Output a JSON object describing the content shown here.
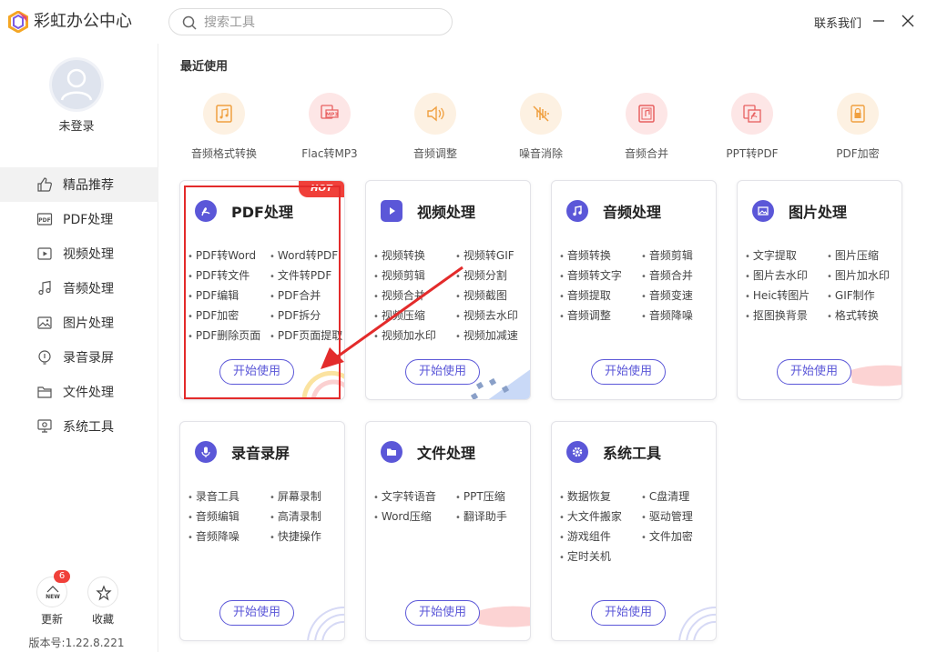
{
  "app": {
    "title": "彩虹办公中心"
  },
  "search": {
    "placeholder": "搜索工具"
  },
  "header": {
    "contact": "联系我们"
  },
  "user": {
    "login_status": "未登录"
  },
  "sidebar": {
    "items": [
      {
        "label": "精品推荐",
        "icon": "thumbs-up-icon",
        "active": true
      },
      {
        "label": "PDF处理",
        "icon": "pdf-icon"
      },
      {
        "label": "视频处理",
        "icon": "video-icon"
      },
      {
        "label": "音频处理",
        "icon": "music-note-icon"
      },
      {
        "label": "图片处理",
        "icon": "image-icon"
      },
      {
        "label": "录音录屏",
        "icon": "lightbulb-icon"
      },
      {
        "label": "文件处理",
        "icon": "folder-icon"
      },
      {
        "label": "系统工具",
        "icon": "monitor-icon"
      }
    ],
    "update": {
      "label": "更新",
      "badge": "6",
      "icon_text": "NEW"
    },
    "favorite": {
      "label": "收藏"
    },
    "version": "版本号:1.22.8.221"
  },
  "recent": {
    "title": "最近使用",
    "items": [
      {
        "label": "音频格式转换",
        "icon": "audio-file-icon",
        "bg": "#fdf1e2",
        "fg": "#f0a040"
      },
      {
        "label": "Flac转MP3",
        "icon": "mp3-icon",
        "bg": "#fde6e6",
        "fg": "#e86060"
      },
      {
        "label": "音频调整",
        "icon": "speaker-icon",
        "bg": "#fdf1e2",
        "fg": "#f0a040"
      },
      {
        "label": "噪音消除",
        "icon": "noise-icon",
        "bg": "#fdf1e2",
        "fg": "#f0a040"
      },
      {
        "label": "音频合并",
        "icon": "audio-merge-icon",
        "bg": "#fde6e6",
        "fg": "#e86060"
      },
      {
        "label": "PPT转PDF",
        "icon": "pdf-file-icon",
        "bg": "#fde6e6",
        "fg": "#e86060"
      },
      {
        "label": "PDF加密",
        "icon": "lock-file-icon",
        "bg": "#fdf1e2",
        "fg": "#f0a040"
      }
    ]
  },
  "cards": {
    "pdf": {
      "title": "PDF处理",
      "hot": "HOT",
      "features": [
        "PDF转Word",
        "Word转PDF",
        "PDF转文件",
        "文件转PDF",
        "PDF编辑",
        "PDF合并",
        "PDF加密",
        "PDF拆分",
        "PDF删除页面",
        "PDF页面提取"
      ],
      "button": "开始使用"
    },
    "video": {
      "title": "视频处理",
      "features": [
        "视频转换",
        "视频转GIF",
        "视频剪辑",
        "视频分割",
        "视频合并",
        "视频截图",
        "视频压缩",
        "视频去水印",
        "视频加水印",
        "视频加减速"
      ],
      "button": "开始使用"
    },
    "audio": {
      "title": "音频处理",
      "features": [
        "音频转换",
        "音频剪辑",
        "音频转文字",
        "音频合并",
        "音频提取",
        "音频变速",
        "音频调整",
        "音频降噪"
      ],
      "button": "开始使用"
    },
    "image": {
      "title": "图片处理",
      "features": [
        "文字提取",
        "图片压缩",
        "图片去水印",
        "图片加水印",
        "Heic转图片",
        "GIF制作",
        "抠图换背景",
        "格式转换"
      ],
      "button": "开始使用"
    },
    "record": {
      "title": "录音录屏",
      "features": [
        "录音工具",
        "屏幕录制",
        "音频编辑",
        "高清录制",
        "音频降噪",
        "快捷操作"
      ],
      "button": "开始使用"
    },
    "file": {
      "title": "文件处理",
      "features": [
        "文字转语音",
        "PPT压缩",
        "Word压缩",
        "翻译助手"
      ],
      "button": "开始使用"
    },
    "system": {
      "title": "系统工具",
      "features": [
        "数据恢复",
        "C盘清理",
        "大文件搬家",
        "驱动管理",
        "游戏组件",
        "文件加密",
        "定时关机"
      ],
      "button": "开始使用"
    }
  },
  "colors": {
    "accent": "#5b57d8",
    "hot": "#f0403a",
    "highlight": "#e32b2b"
  }
}
